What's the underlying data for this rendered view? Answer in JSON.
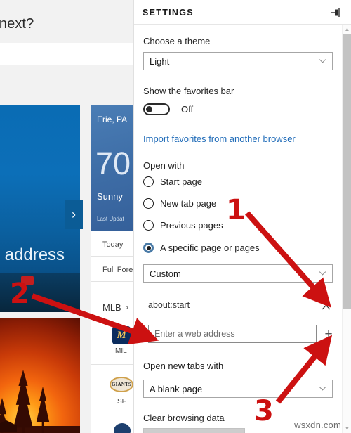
{
  "background": {
    "topbar_text": "o next?",
    "hero": {
      "chevron_icon": "chevron-right-icon",
      "caption": "r address"
    },
    "weather": {
      "city": "Erie, PA",
      "temperature": "70",
      "condition": "Sunny",
      "last_updated": "Last Updat",
      "rows": [
        "Today",
        "Full Forec"
      ]
    },
    "sports": {
      "league": "MLB",
      "league_chevron": "chevron-right-icon",
      "teams": [
        {
          "logo_text": "M",
          "abbr": "MIL"
        },
        {
          "logo_text": "GIANTS",
          "abbr": "SF"
        },
        {
          "logo_text": "",
          "abbr": ""
        }
      ]
    }
  },
  "pane": {
    "title": "SETTINGS",
    "pin_icon": "pin-icon",
    "theme": {
      "label": "Choose a theme",
      "value": "Light",
      "chevron_icon": "chevron-down-icon"
    },
    "favorites_bar": {
      "label": "Show the favorites bar",
      "state": "Off",
      "toggle_icon": "toggle-switch-off-icon"
    },
    "import_link": "Import favorites from another browser",
    "open_with": {
      "label": "Open with",
      "options": [
        {
          "label": "Start page",
          "selected": false
        },
        {
          "label": "New tab page",
          "selected": false
        },
        {
          "label": "Previous pages",
          "selected": false
        },
        {
          "label": "A specific page or pages",
          "selected": true
        }
      ]
    },
    "custom_select": {
      "value": "Custom",
      "chevron_icon": "chevron-down-icon"
    },
    "start_url": {
      "value": "about:start",
      "remove_icon": "close-x-icon"
    },
    "new_url": {
      "value": "",
      "placeholder": "Enter a web address",
      "add_icon": "plus-icon"
    },
    "new_tabs": {
      "label": "Open new tabs with",
      "value": "A blank page",
      "chevron_icon": "chevron-down-icon"
    },
    "clear_browsing": {
      "label": "Clear browsing data",
      "button_label": ""
    },
    "scrollbar": {
      "up_icon": "scroll-up-icon",
      "down_icon": "scroll-down-icon"
    }
  },
  "annotations": {
    "accent_color": "#cc1111",
    "markers": [
      {
        "number": "1",
        "points_to": "remove-start-url-x-button"
      },
      {
        "number": "2",
        "points_to": "new-url-input"
      },
      {
        "number": "3",
        "points_to": "add-url-plus-button"
      }
    ]
  },
  "watermark": "wsxdn.com"
}
